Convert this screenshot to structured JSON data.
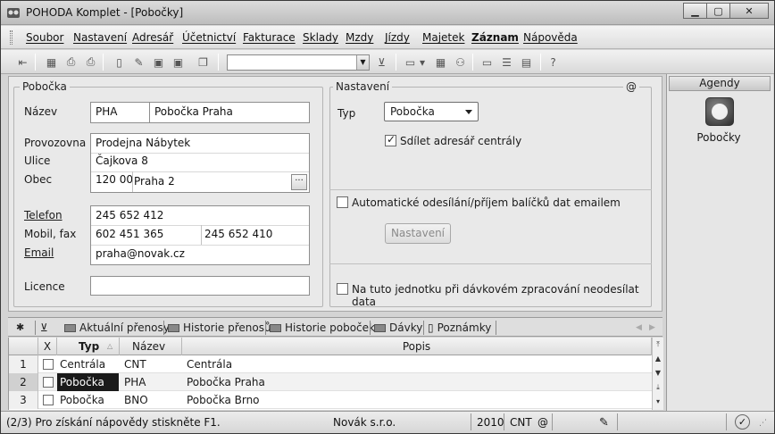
{
  "window": {
    "title": "POHODA Komplet - [Pobočky]"
  },
  "menu": [
    "Soubor",
    "Nastavení",
    "Adresář",
    "Účetnictví",
    "Fakturace",
    "Sklady",
    "Mzdy",
    "Jízdy",
    "Majetek",
    "Záznam",
    "Nápověda"
  ],
  "pobocka": {
    "title": "Pobočka",
    "nazev_label": "Název",
    "kod": "PHA",
    "nazev": "Pobočka Praha",
    "provozovna_label": "Provozovna",
    "provozovna": "Prodejna Nábytek",
    "ulice_label": "Ulice",
    "ulice": "Čajkova 8",
    "obec_label": "Obec",
    "psc": "120 00",
    "obec": "Praha 2",
    "telefon_label": "Telefon",
    "telefon": "245 652 412",
    "mobil_label": "Mobil, fax",
    "mobil": "602 451 365",
    "fax": "245 652 410",
    "email_label": "Email",
    "email": "praha@novak.cz",
    "licence_label": "Licence",
    "licence": ""
  },
  "nastaveni": {
    "title": "Nastavení",
    "at": "@",
    "typ_label": "Typ",
    "typ_value": "Pobočka",
    "sdilet_label": "Sdílet adresář centrály",
    "auto_label": "Automatické odesílání/příjem balíčků dat emailem",
    "nastaveni_button": "Nastavení",
    "neodesilat_label": "Na tuto jednotku při dávkovém zpracování neodesílat data"
  },
  "agendy": {
    "title": "Agendy",
    "item": "Pobočky"
  },
  "tabs": [
    "Aktuální přenosy",
    "Historie přenosů",
    "Historie poboček",
    "Dávky",
    "Poznámky"
  ],
  "grid": {
    "headers": {
      "x": "X",
      "typ": "Typ",
      "nazev": "Název",
      "popis": "Popis"
    },
    "rows": [
      {
        "num": "1",
        "typ": "Centrála",
        "nazev": "CNT",
        "popis": "Centrála"
      },
      {
        "num": "2",
        "typ": "Pobočka",
        "nazev": "PHA",
        "popis": "Pobočka Praha"
      },
      {
        "num": "3",
        "typ": "Pobočka",
        "nazev": "BNO",
        "popis": "Pobočka Brno"
      }
    ]
  },
  "status": {
    "help": "(2/3) Pro získání nápovědy stiskněte F1.",
    "company": "Novák s.r.o.",
    "year": "2010",
    "unit": "CNT",
    "at": "@"
  }
}
